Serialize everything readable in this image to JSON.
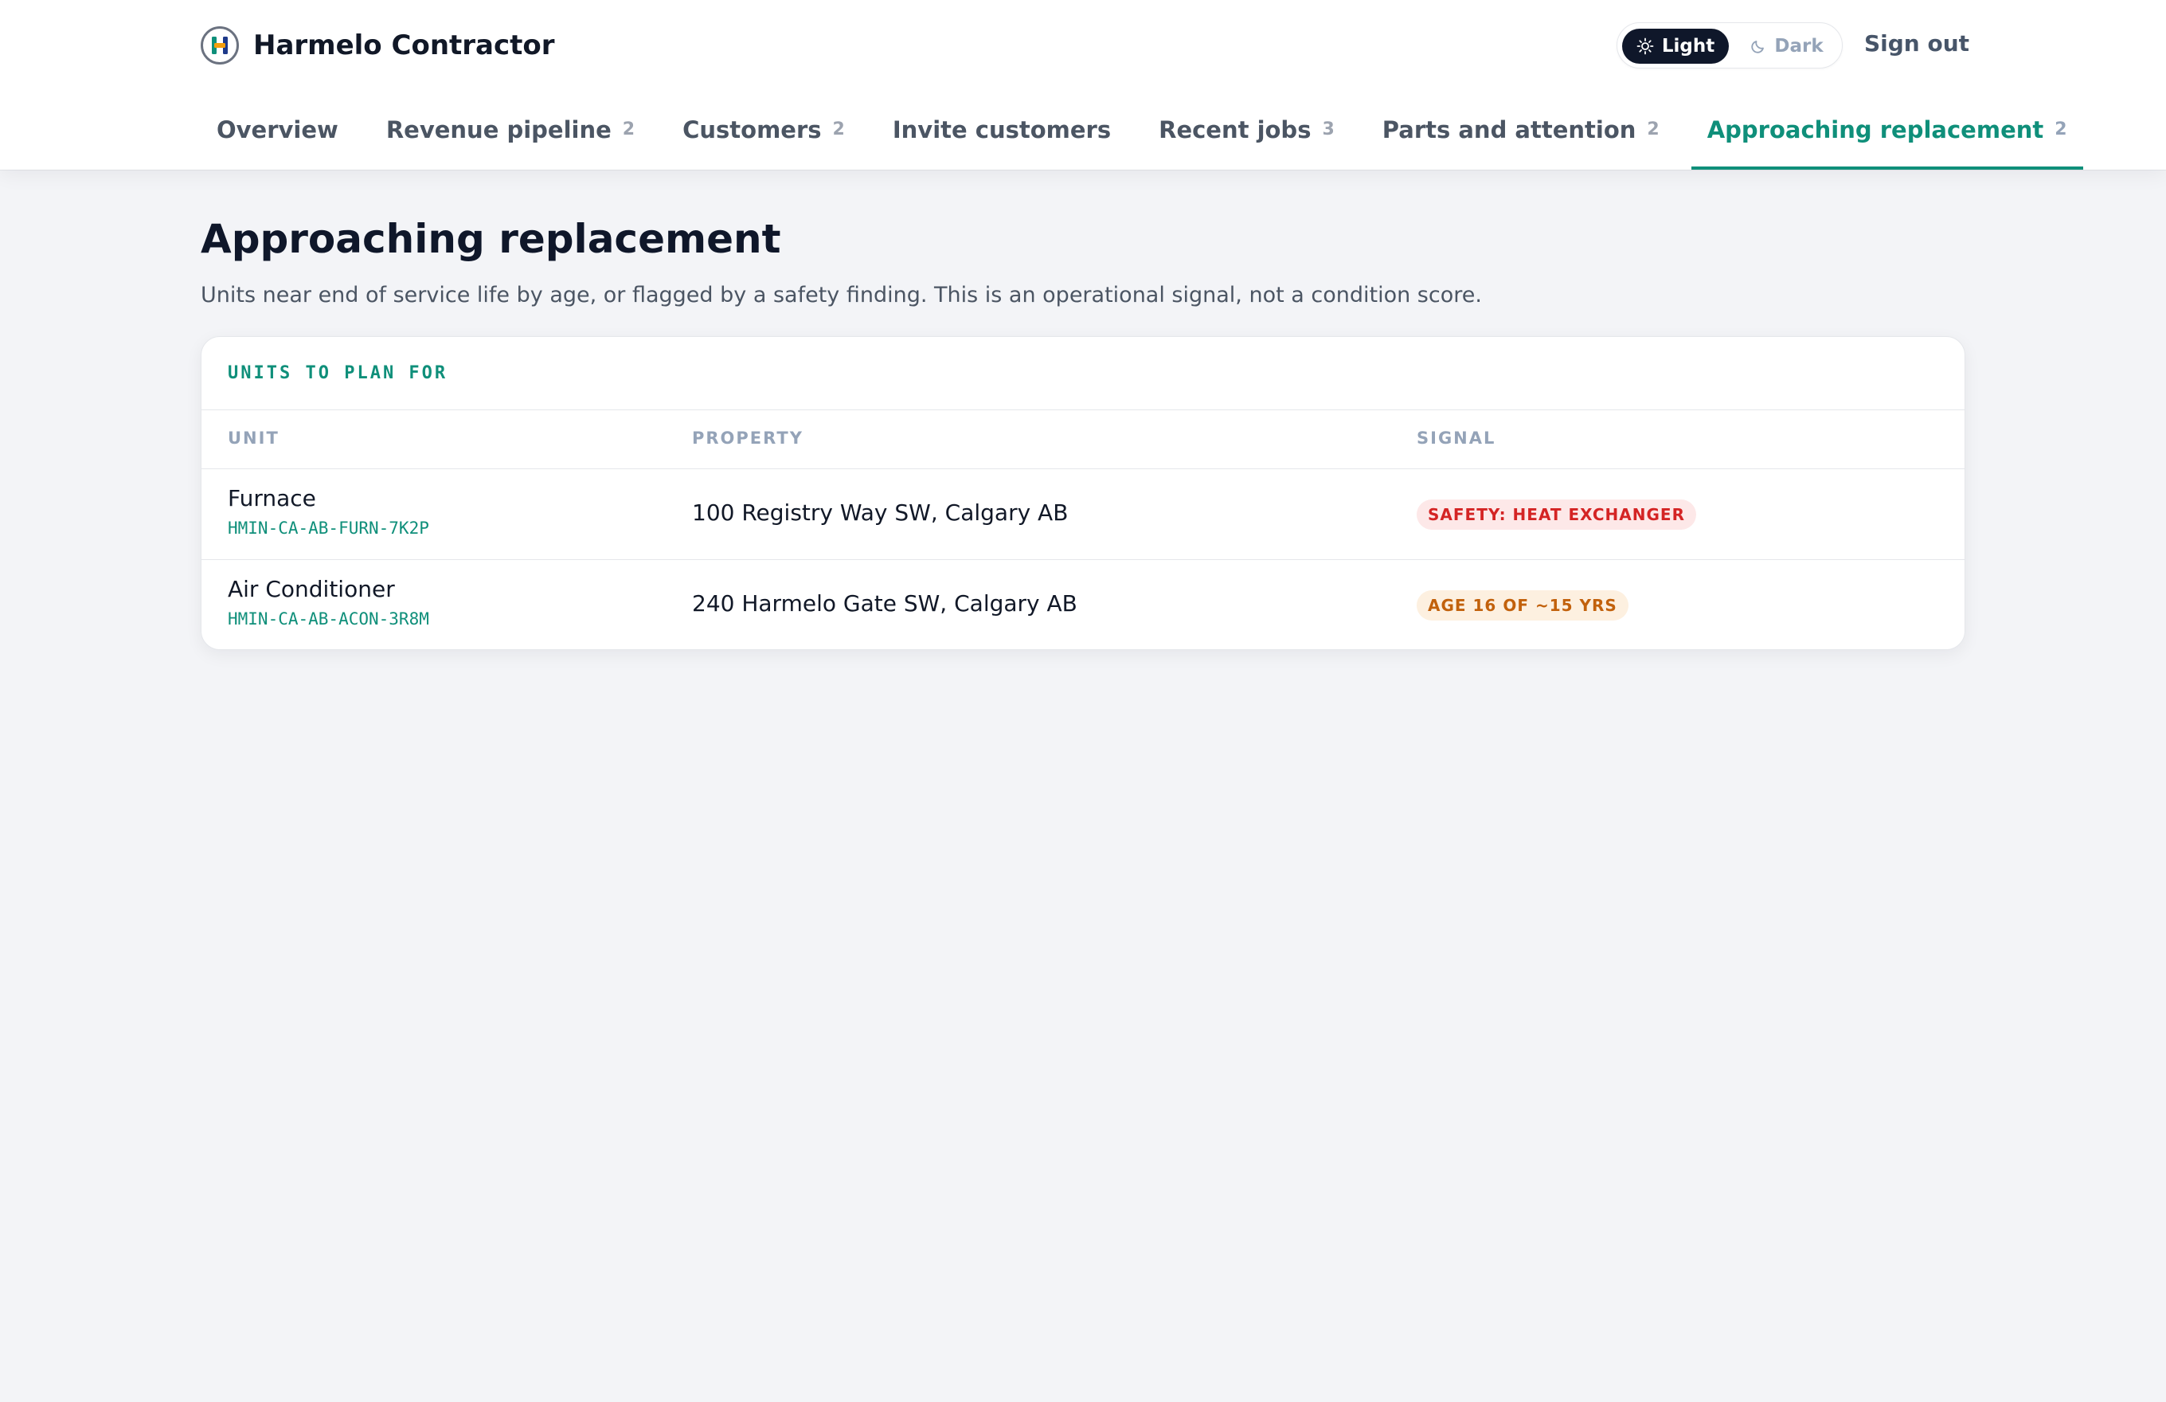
{
  "app": {
    "name": "Harmelo Contractor",
    "logo_icon": "harmelo-logo-icon"
  },
  "theme": {
    "light_label": "Light",
    "dark_label": "Dark",
    "selected": "Light"
  },
  "header": {
    "signout_label": "Sign out"
  },
  "tabs": [
    {
      "label": "Overview",
      "count": ""
    },
    {
      "label": "Revenue pipeline",
      "count": "2"
    },
    {
      "label": "Customers",
      "count": "2"
    },
    {
      "label": "Invite customers",
      "count": ""
    },
    {
      "label": "Recent jobs",
      "count": "3"
    },
    {
      "label": "Parts and attention",
      "count": "2"
    },
    {
      "label": "Approaching replacement",
      "count": "2",
      "active": true
    }
  ],
  "page": {
    "title": "Approaching replacement",
    "subtitle": "Units near end of service life by age, or flagged by a safety finding. This is an operational signal, not a condition score."
  },
  "card": {
    "title": "UNITS TO PLAN FOR",
    "columns": [
      "UNIT",
      "PROPERTY",
      "SIGNAL"
    ],
    "rows": [
      {
        "unit": "Furnace",
        "unit_id": "HMIN-CA-AB-FURN-7K2P",
        "property": "100 Registry Way SW, Calgary AB",
        "signal": "SAFETY: HEAT EXCHANGER",
        "signal_color": "#d42424"
      },
      {
        "unit": "Air Conditioner",
        "unit_id": "HMIN-CA-AB-ACON-3R8M",
        "property": "240 Harmelo Gate SW, Calgary AB",
        "signal": "AGE 16 OF ~15 YRS",
        "signal_color": "#c2610c"
      }
    ]
  },
  "colors": {
    "accent": "#0f8f7a",
    "background": "#f3f4f7",
    "danger": "#d42424",
    "warning": "#c2610c"
  }
}
